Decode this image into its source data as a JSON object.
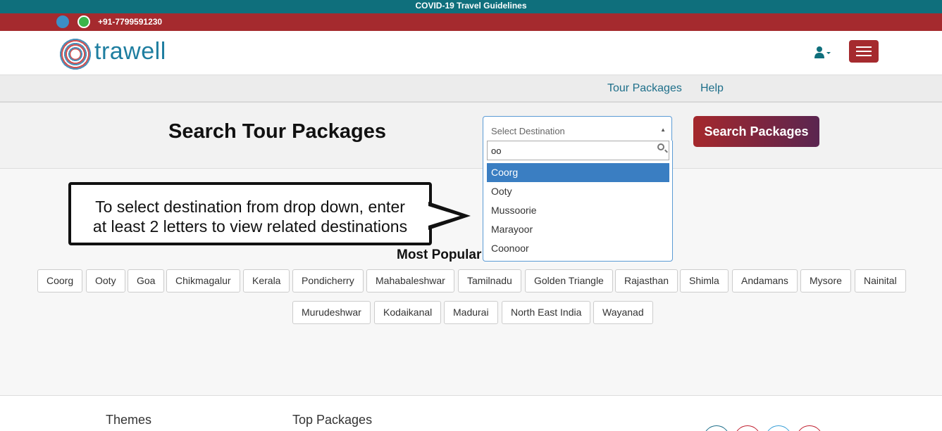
{
  "covid_bar": {
    "text": "COVID-19 Travel Guidelines"
  },
  "contact": {
    "phone": "+91-7799591230"
  },
  "header": {
    "logo_text": "trawell"
  },
  "nav": {
    "tour_packages": "Tour Packages",
    "help": "Help"
  },
  "search": {
    "title": "Search Tour Packages",
    "select_placeholder": "Select Destination",
    "button": "Search Packages",
    "query": "oo",
    "results": [
      "Coorg",
      "Ooty",
      "Mussoorie",
      "Marayoor",
      "Coonoor"
    ]
  },
  "callout": {
    "line1": "To select destination from drop down, enter",
    "line2": "at least 2 letters to view related destinations"
  },
  "popular": {
    "title": "Most Popular",
    "tags_row1": [
      "Coorg",
      "Ooty",
      "Goa",
      "Chikmagalur",
      "Kerala",
      "Pondicherry",
      "Mahabaleshwar",
      "Tamilnadu",
      "Golden Triangle",
      "Rajasthan",
      "Shimla",
      "Andamans",
      "Mysore",
      "Nainital"
    ],
    "tags_row2": [
      "Murudeshwar",
      "Kodaikanal",
      "Madurai",
      "North East India",
      "Wayanad"
    ]
  },
  "footer": {
    "themes": "Themes",
    "top_packages": "Top Packages"
  },
  "colors": {
    "teal": "#0f6f7c",
    "maroon": "#a52a2e",
    "select_blue": "#3a7ec2"
  }
}
